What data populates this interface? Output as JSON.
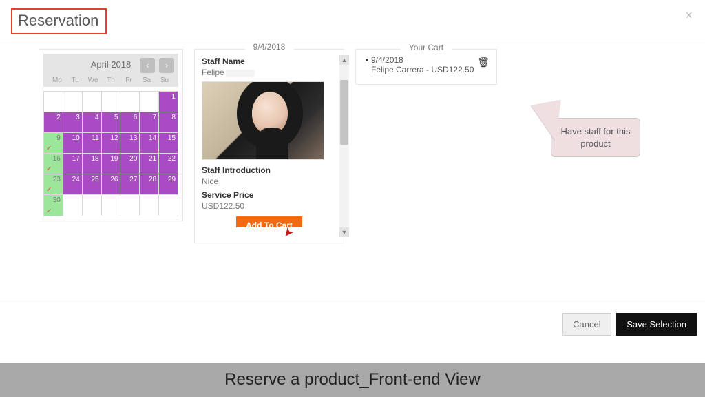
{
  "title": "Reservation",
  "calendar": {
    "month_label": "April 2018",
    "dow": [
      "Mo",
      "Tu",
      "We",
      "Th",
      "Fr",
      "Sa",
      "Su"
    ],
    "weeks": [
      [
        {
          "n": "",
          "t": "empty"
        },
        {
          "n": "",
          "t": "empty"
        },
        {
          "n": "",
          "t": "empty"
        },
        {
          "n": "",
          "t": "empty"
        },
        {
          "n": "",
          "t": "empty"
        },
        {
          "n": "",
          "t": "empty"
        },
        {
          "n": "1",
          "t": "fill"
        }
      ],
      [
        {
          "n": "2",
          "t": "fill"
        },
        {
          "n": "3",
          "t": "fill"
        },
        {
          "n": "4",
          "t": "fill"
        },
        {
          "n": "5",
          "t": "fill"
        },
        {
          "n": "6",
          "t": "fill"
        },
        {
          "n": "7",
          "t": "fill"
        },
        {
          "n": "8",
          "t": "fill"
        }
      ],
      [
        {
          "n": "9",
          "t": "green"
        },
        {
          "n": "10",
          "t": "fill"
        },
        {
          "n": "11",
          "t": "fill"
        },
        {
          "n": "12",
          "t": "fill"
        },
        {
          "n": "13",
          "t": "fill"
        },
        {
          "n": "14",
          "t": "fill"
        },
        {
          "n": "15",
          "t": "fill"
        }
      ],
      [
        {
          "n": "16",
          "t": "green"
        },
        {
          "n": "17",
          "t": "fill"
        },
        {
          "n": "18",
          "t": "fill"
        },
        {
          "n": "19",
          "t": "fill"
        },
        {
          "n": "20",
          "t": "fill"
        },
        {
          "n": "21",
          "t": "fill"
        },
        {
          "n": "22",
          "t": "fill"
        }
      ],
      [
        {
          "n": "23",
          "t": "green"
        },
        {
          "n": "24",
          "t": "fill"
        },
        {
          "n": "25",
          "t": "fill"
        },
        {
          "n": "26",
          "t": "fill"
        },
        {
          "n": "27",
          "t": "fill"
        },
        {
          "n": "28",
          "t": "fill"
        },
        {
          "n": "29",
          "t": "fill"
        }
      ],
      [
        {
          "n": "30",
          "t": "green"
        },
        {
          "n": "",
          "t": "blank"
        },
        {
          "n": "",
          "t": "blank"
        },
        {
          "n": "",
          "t": "blank"
        },
        {
          "n": "",
          "t": "blank"
        },
        {
          "n": "",
          "t": "blank"
        },
        {
          "n": "",
          "t": "blank"
        }
      ]
    ]
  },
  "detail": {
    "date": "9/4/2018",
    "staff_name_label": "Staff Name",
    "staff_name_value": "Felipe",
    "intro_label": "Staff Introduction",
    "intro_value": "Nice",
    "price_label": "Service Price",
    "price_value": "USD122.50",
    "add_to_cart": "Add To Cart"
  },
  "callout_text": "Have staff for this product",
  "cart": {
    "title": "Your Cart",
    "items": [
      {
        "line1": "9/4/2018",
        "line2": "Felipe Carrera - USD122.50"
      }
    ]
  },
  "footer": {
    "cancel": "Cancel",
    "save": "Save Selection"
  },
  "caption": "Reserve a product_Front-end View"
}
